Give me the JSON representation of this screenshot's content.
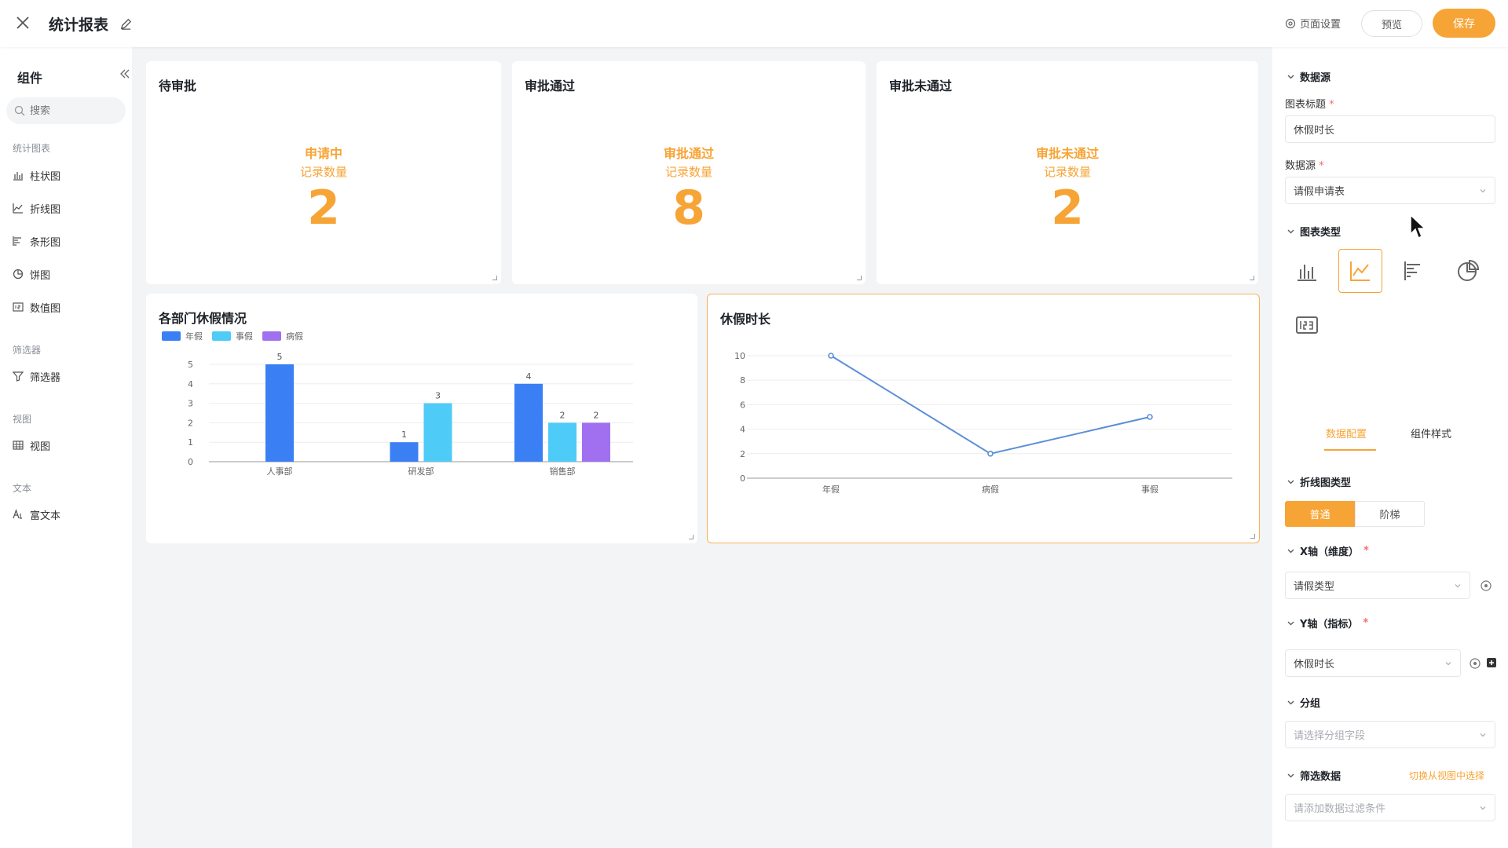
{
  "header": {
    "title": "统计报表",
    "page_settings": "页面设置",
    "preview": "预览",
    "save": "保存"
  },
  "sidebar": {
    "title": "组件",
    "search_placeholder": "搜索",
    "groups": [
      {
        "label": "统计图表",
        "items": [
          "柱状图",
          "折线图",
          "条形图",
          "饼图",
          "数值图"
        ]
      },
      {
        "label": "筛选器",
        "items": [
          "筛选器"
        ]
      },
      {
        "label": "视图",
        "items": [
          "视图"
        ]
      },
      {
        "label": "文本",
        "items": [
          "富文本"
        ]
      }
    ]
  },
  "stats": [
    {
      "title": "待审批",
      "status": "申请中",
      "label": "记录数量",
      "value": "2"
    },
    {
      "title": "审批通过",
      "status": "审批通过",
      "label": "记录数量",
      "value": "8"
    },
    {
      "title": "审批未通过",
      "status": "审批未通过",
      "label": "记录数量",
      "value": "2"
    }
  ],
  "colors": {
    "accent": "#f7a436",
    "annual": "#3b7ff5",
    "personal": "#4ecbf7",
    "sick": "#a070f0",
    "line": "#5b8fd6"
  },
  "chart_data": [
    {
      "type": "bar",
      "title": "各部门休假情况",
      "categories": [
        "人事部",
        "研发部",
        "销售部"
      ],
      "series": [
        {
          "name": "年假",
          "values": [
            5,
            1,
            4
          ]
        },
        {
          "name": "事假",
          "values": [
            null,
            3,
            2
          ]
        },
        {
          "name": "病假",
          "values": [
            null,
            null,
            2
          ]
        }
      ],
      "ylim": [
        0,
        5
      ],
      "yticks": [
        0,
        1,
        2,
        3,
        4,
        5
      ],
      "legend": "top-left",
      "grid": true
    },
    {
      "type": "line",
      "title": "休假时长",
      "categories": [
        "年假",
        "病假",
        "事假"
      ],
      "values": [
        10,
        2,
        5
      ],
      "ylim": [
        0,
        10
      ],
      "yticks": [
        0,
        2,
        4,
        6,
        8,
        10
      ],
      "grid": true
    }
  ],
  "panel": {
    "section_datasource": "数据源",
    "chart_title_label": "图表标题",
    "chart_title_value": "休假时长",
    "datasource_label": "数据源",
    "datasource_value": "请假申请表",
    "section_chart_type": "图表类型",
    "tab_data": "数据配置",
    "tab_style": "组件样式",
    "section_line_type": "折线图类型",
    "line_normal": "普通",
    "line_step": "阶梯",
    "section_x": "X轴（维度）",
    "x_value": "请假类型",
    "section_y": "Y轴（指标）",
    "y_value": "休假时长",
    "section_group": "分组",
    "group_placeholder": "请选择分组字段",
    "section_filter": "筛选数据",
    "filter_link": "切换从视图中选择",
    "filter_placeholder": "请添加数据过滤条件"
  }
}
